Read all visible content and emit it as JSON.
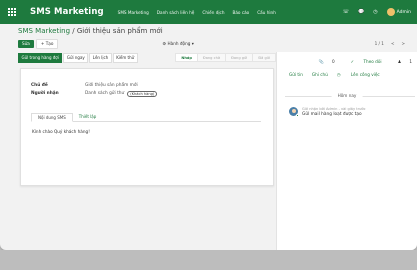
{
  "navbar": {
    "brand": "SMS Marketing",
    "menu": [
      "SMS Marketing",
      "Danh sách liên hệ",
      "Chiến dịch",
      "Báo cáo",
      "Cấu hình"
    ],
    "user": "Admin",
    "bg_color": "#1e7a3e"
  },
  "breadcrumb": {
    "parent": "SMS Marketing",
    "separator": "/",
    "current": "Giới thiệu sản phẩm mới"
  },
  "controls": {
    "edit": "Sửa",
    "create": "+ Tạo",
    "action": "Hành động",
    "pager": "1 / 1",
    "prev": "<",
    "next": ">"
  },
  "status_buttons": [
    {
      "label": "Gửi trong hàng đợi",
      "primary": true
    },
    {
      "label": "Gửi ngay",
      "primary": false
    },
    {
      "label": "Lên lịch",
      "primary": false
    },
    {
      "label": "Kiểm thử",
      "primary": false
    }
  ],
  "stages": [
    {
      "label": "Nháp",
      "active": true
    },
    {
      "label": "Đang chờ",
      "active": false
    },
    {
      "label": "Đang gửi",
      "active": false
    },
    {
      "label": "Đã gửi",
      "active": false
    }
  ],
  "form": {
    "subject_label": "Chủ đề",
    "subject_value": "Giới thiệu sản phẩm mới",
    "recipient_label": "Người nhận",
    "recipient_value": "Danh sách gửi thư",
    "recipient_tag": "(Khách hàng)",
    "tabs": [
      "Nội dung SMS",
      "Thiết lập"
    ],
    "body": "Kính chào Quý khách hàng!"
  },
  "chatter": {
    "attachments": "0",
    "follow": "Theo dõi",
    "followers": "1",
    "send_message": "Gửi tin",
    "log_note": "Ghi chú",
    "schedule": "Lên công việc",
    "today": "Hôm nay",
    "message_head": "Gửi nhận bởi Admin - vài giây trước",
    "message_text": "Gửi mail hàng loạt được tạo"
  }
}
